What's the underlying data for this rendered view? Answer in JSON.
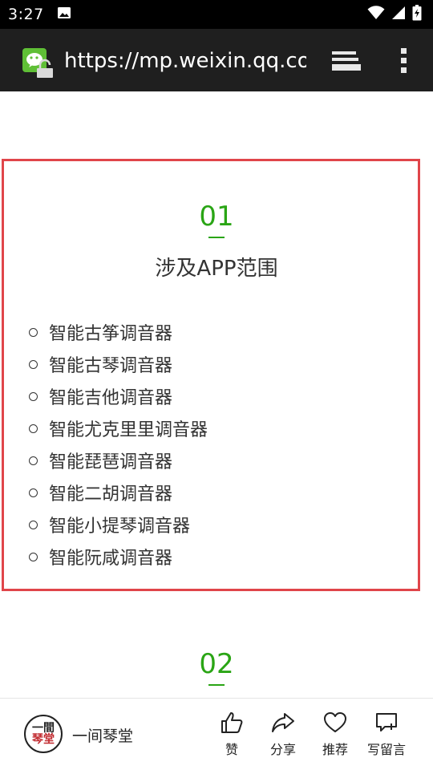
{
  "status_bar": {
    "time": "3:27",
    "icons": [
      "image-notification-icon",
      "wifi-icon",
      "signal-icon",
      "battery-charging-icon"
    ]
  },
  "browser": {
    "url": "https://mp.weixin.qq.com",
    "site_icon": "wechat-icon",
    "actions": [
      "tabs-icon",
      "more-vert-icon"
    ]
  },
  "article": {
    "section1": {
      "number": "01",
      "title": "涉及APP范围",
      "items": [
        "智能古筝调音器",
        "智能古琴调音器",
        "智能吉他调音器",
        "智能尤克里里调音器",
        "智能琵琶调音器",
        "智能二胡调音器",
        "智能小提琴调音器",
        "智能阮咸调音器"
      ]
    },
    "section2": {
      "number": "02"
    },
    "colors": {
      "accent": "#2aa515",
      "highlight_border": "#e0454a",
      "text": "#333333"
    }
  },
  "bottom_bar": {
    "avatar_top": "一間",
    "avatar_bottom": "琴堂",
    "account_name": "一间琴堂",
    "actions": {
      "like": "赞",
      "share": "分享",
      "recommend": "推荐",
      "comment": "写留言"
    }
  }
}
